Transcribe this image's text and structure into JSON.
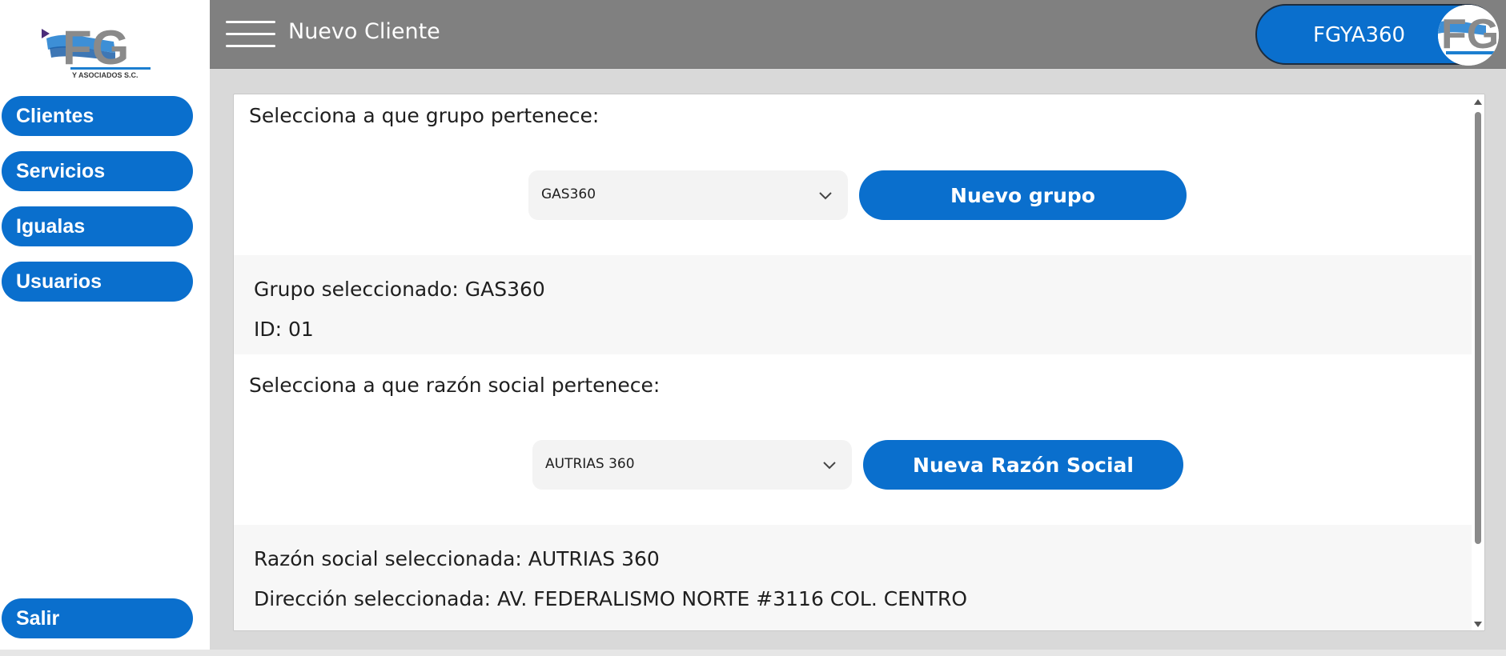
{
  "app": {
    "logo_text": "FG",
    "logo_subtext": "Y ASOCIADOS S.C."
  },
  "sidebar": {
    "items": [
      {
        "label": "Clientes"
      },
      {
        "label": "Servicios"
      },
      {
        "label": "Igualas"
      },
      {
        "label": "Usuarios"
      }
    ],
    "logout_label": "Salir"
  },
  "header": {
    "title": "Nuevo Cliente",
    "user_name": "FGYA360"
  },
  "form": {
    "group_prompt": "Selecciona a que grupo pertenece:",
    "group_select_value": "GAS360",
    "new_group_label": "Nuevo grupo",
    "group_selected_text": "Grupo seleccionado: GAS360",
    "group_id_text": "ID: 01",
    "company_prompt": "Selecciona a que razón social pertenece:",
    "company_select_value": "AUTRIAS 360",
    "new_company_label": "Nueva Razón Social",
    "company_selected_text": "Razón social seleccionada: AUTRIAS 360",
    "address_selected_text": "Dirección seleccionada: AV. FEDERALISMO NORTE #3116 COL. CENTRO"
  },
  "colors": {
    "accent": "#0a6fcd",
    "header_bg": "#808080",
    "main_bg": "#d9d9d9"
  },
  "icons": {
    "menu": "hamburger-icon",
    "dropdown": "chevron-down-icon"
  }
}
